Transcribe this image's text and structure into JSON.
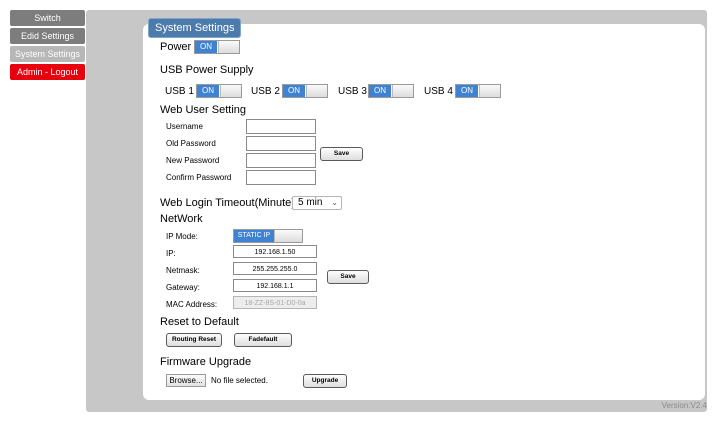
{
  "sidebar": {
    "items": [
      {
        "label": "Switch"
      },
      {
        "label": "Edid Settings"
      },
      {
        "label": "System Settings"
      },
      {
        "label": "Admin - Logout"
      }
    ]
  },
  "panel": {
    "title": "System Settings"
  },
  "power": {
    "label": "Power",
    "state": "ON"
  },
  "usb": {
    "title": "USB Power Supply",
    "items": [
      {
        "label": "USB 1",
        "state": "ON"
      },
      {
        "label": "USB 2",
        "state": "ON"
      },
      {
        "label": "USB 3",
        "state": "ON"
      },
      {
        "label": "USB 4",
        "state": "ON"
      }
    ]
  },
  "web_user": {
    "title": "Web User Setting",
    "username_label": "Username",
    "old_password_label": "Old Password",
    "new_password_label": "New Password",
    "confirm_password_label": "Confirm Password",
    "save_label": "Save"
  },
  "timeout": {
    "label": "Web Login Timeout(Minute)",
    "value": "5 min"
  },
  "network": {
    "title": "NetWork",
    "ip_mode_label": "IP Mode:",
    "ip_mode_value": "STATIC IP",
    "ip_label": "IP:",
    "ip_value": "192.168.1.50",
    "netmask_label": "Netmask:",
    "netmask_value": "255.255.255.0",
    "gateway_label": "Gateway:",
    "gateway_value": "192.168.1.1",
    "mac_label": "MAC Address:",
    "mac_value": "18-ZZ-8S-01-D0-0a",
    "save_label": "Save"
  },
  "reset": {
    "title": "Reset to Default",
    "routing_reset_label": "Routing Reset",
    "fadefault_label": "Fadefault"
  },
  "firmware": {
    "title": "Firmware Upgrade",
    "browse_label": "Browse...",
    "file_status": "No file selected.",
    "upgrade_label": "Upgrade"
  },
  "version": "Version:V2.4",
  "colors": {
    "accent": "#3f82d2",
    "legend": "#4c7aaa",
    "logout": "#e8000f",
    "sidebar_gray": "#7d7d7d"
  }
}
